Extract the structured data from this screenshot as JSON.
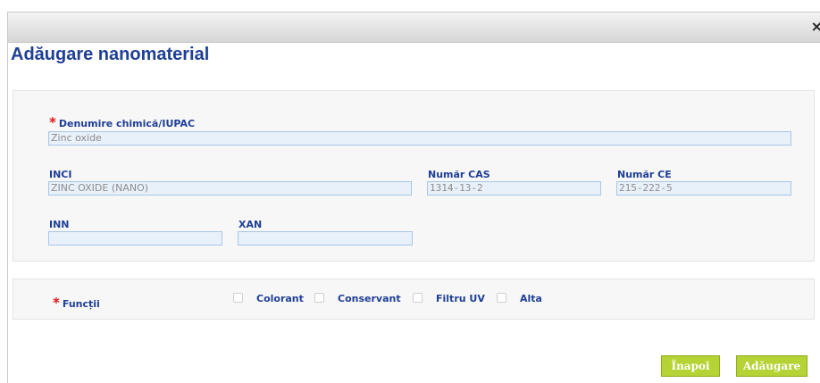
{
  "window": {
    "close_label": "×"
  },
  "heading": "Adăugare nanomaterial",
  "form": {
    "chemical_name": {
      "required_mark": "*",
      "label": "Denumire chimică/IUPAC",
      "value": "Zinc oxide"
    },
    "inci": {
      "label": "INCI",
      "value": "ZINC OXIDE (NANO)"
    },
    "cas": {
      "label": "Număr CAS",
      "value": "1314-13-2"
    },
    "ce": {
      "label": "Număr CE",
      "value": "215-222-5"
    },
    "inn": {
      "label": "INN",
      "value": ""
    },
    "xan": {
      "label": "XAN",
      "value": ""
    }
  },
  "functions": {
    "required_mark": "*",
    "label": "Funcții",
    "options": [
      {
        "label": "Colorant",
        "checked": false
      },
      {
        "label": "Conservant",
        "checked": false
      },
      {
        "label": "Filtru UV",
        "checked": false
      },
      {
        "label": "Alta",
        "checked": false
      }
    ]
  },
  "buttons": {
    "back_label": "Înapoi",
    "add_label": "Adăugare"
  },
  "colors": {
    "title_blue": "#1f3f95",
    "required_red": "#e0161b",
    "button_green": "#b5d334",
    "input_bg": "#e8f0fa"
  }
}
